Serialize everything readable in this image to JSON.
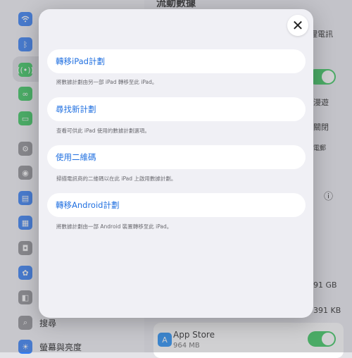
{
  "sidebar": {
    "items": [
      {
        "label": "W",
        "icon": "wifi-icon",
        "color": "#2f7cf6"
      },
      {
        "label": "",
        "icon": "bluetooth-icon",
        "color": "#2f7cf6"
      },
      {
        "label": "",
        "icon": "cellular-icon",
        "color": "#34c759"
      },
      {
        "label": "",
        "icon": "hotspot-icon",
        "color": "#34c759"
      },
      {
        "label": "",
        "icon": "battery-icon",
        "color": "#34c759"
      },
      {
        "label": "",
        "icon": "general-icon",
        "color": "#8e8e93"
      },
      {
        "label": "",
        "icon": "control-center-icon",
        "color": "#8e8e93"
      },
      {
        "label": "",
        "icon": "display-icon",
        "color": "#2f7cf6"
      },
      {
        "label": "",
        "icon": "home-screen-icon",
        "color": "#2f7cf6"
      },
      {
        "label": "",
        "icon": "camera-icon",
        "color": "#8e8e93"
      },
      {
        "label": "",
        "icon": "accessibility-icon",
        "color": "#2f7cf6"
      },
      {
        "label": "",
        "icon": "wallpaper-icon",
        "color": "#8e8e93"
      },
      {
        "label": "搜尋",
        "icon": "search-icon",
        "color": "#8e8e93"
      },
      {
        "label": "螢幕與亮度",
        "icon": "brightness-icon",
        "color": "#2f7cf6"
      }
    ]
  },
  "pane": {
    "header": "流動數據",
    "text1": "理電訊",
    "storage1": "91 GB",
    "storage2": "391 KB",
    "right1": "漫遊",
    "right2": "關閉",
    "right3": "電郵",
    "app_name": "App Store",
    "app_size": "964 MB"
  },
  "modal": {
    "options": [
      {
        "label": "轉移iPad計劃",
        "desc": "將數據計劃由另一部 iPad 轉移至此 iPad。"
      },
      {
        "label": "尋找新計劃",
        "desc": "查看可供此 iPad 使用的數據計劃選項。"
      },
      {
        "label": "使用二維碼",
        "desc": "掃描電訊商的二維碼以在此 iPad 上啟用數據計劃。"
      },
      {
        "label": "轉移Android計劃",
        "desc": "將數據計劃由一部 Android 裝置轉移至此 iPad。"
      }
    ]
  }
}
